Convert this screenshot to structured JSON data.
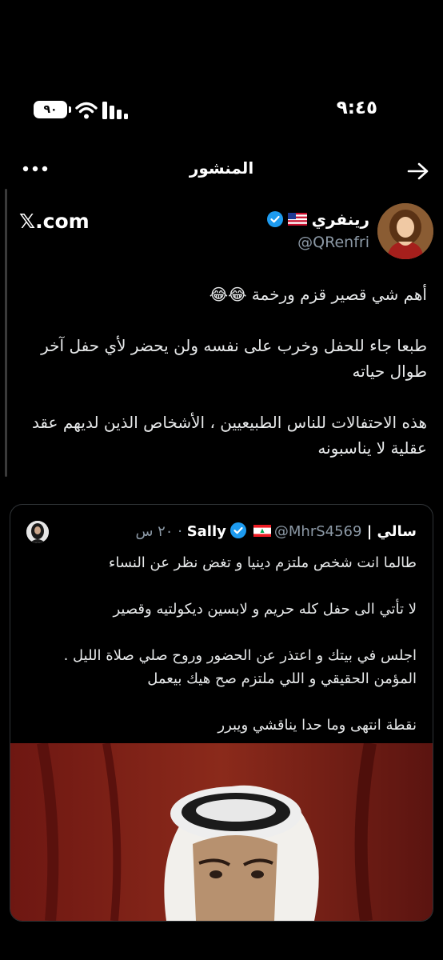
{
  "status_bar": {
    "time": "٩:٤٥",
    "battery": "٩٠"
  },
  "header": {
    "title": "المنشور"
  },
  "post": {
    "author_name": "رينفري",
    "handle": "@QRenfri",
    "site": "𝕏.com",
    "text": "أهم شي قصير قزم ورخمة 😂😂\n\nطبعا جاء للحفل وخرب على نفسه ولن يحضر لأي حفل آخر طوال حياته\n\nهذه الاحتفالات للناس الطبيعيين ، الأشخاص الذين لديهم عقد عقلية لا يناسبونه"
  },
  "quoted_post": {
    "author_name": "سالي | Sally",
    "handle": "@MhrS4569",
    "time": "٢٠ س",
    "text": "طالما انت شخص ملتزم دينيا و تغض نظر  عن النساء\n\nلا تأتي الى حفل كله حريم و لابسين ديكولتيه وقصير\n\nاجلس في بيتك و اعتذر عن الحضور  وروح صلي صلاة الليل . المؤمن الحقيقي و اللي ملتزم صح هيك بيعمل\n\nنقطة انتهى وما حدا يناقشي ويبرر"
  },
  "colors": {
    "background": "#000000",
    "secondary_text": "#8b98a5",
    "verified_blue": "#1d9bf0",
    "border": "#2f3336"
  }
}
